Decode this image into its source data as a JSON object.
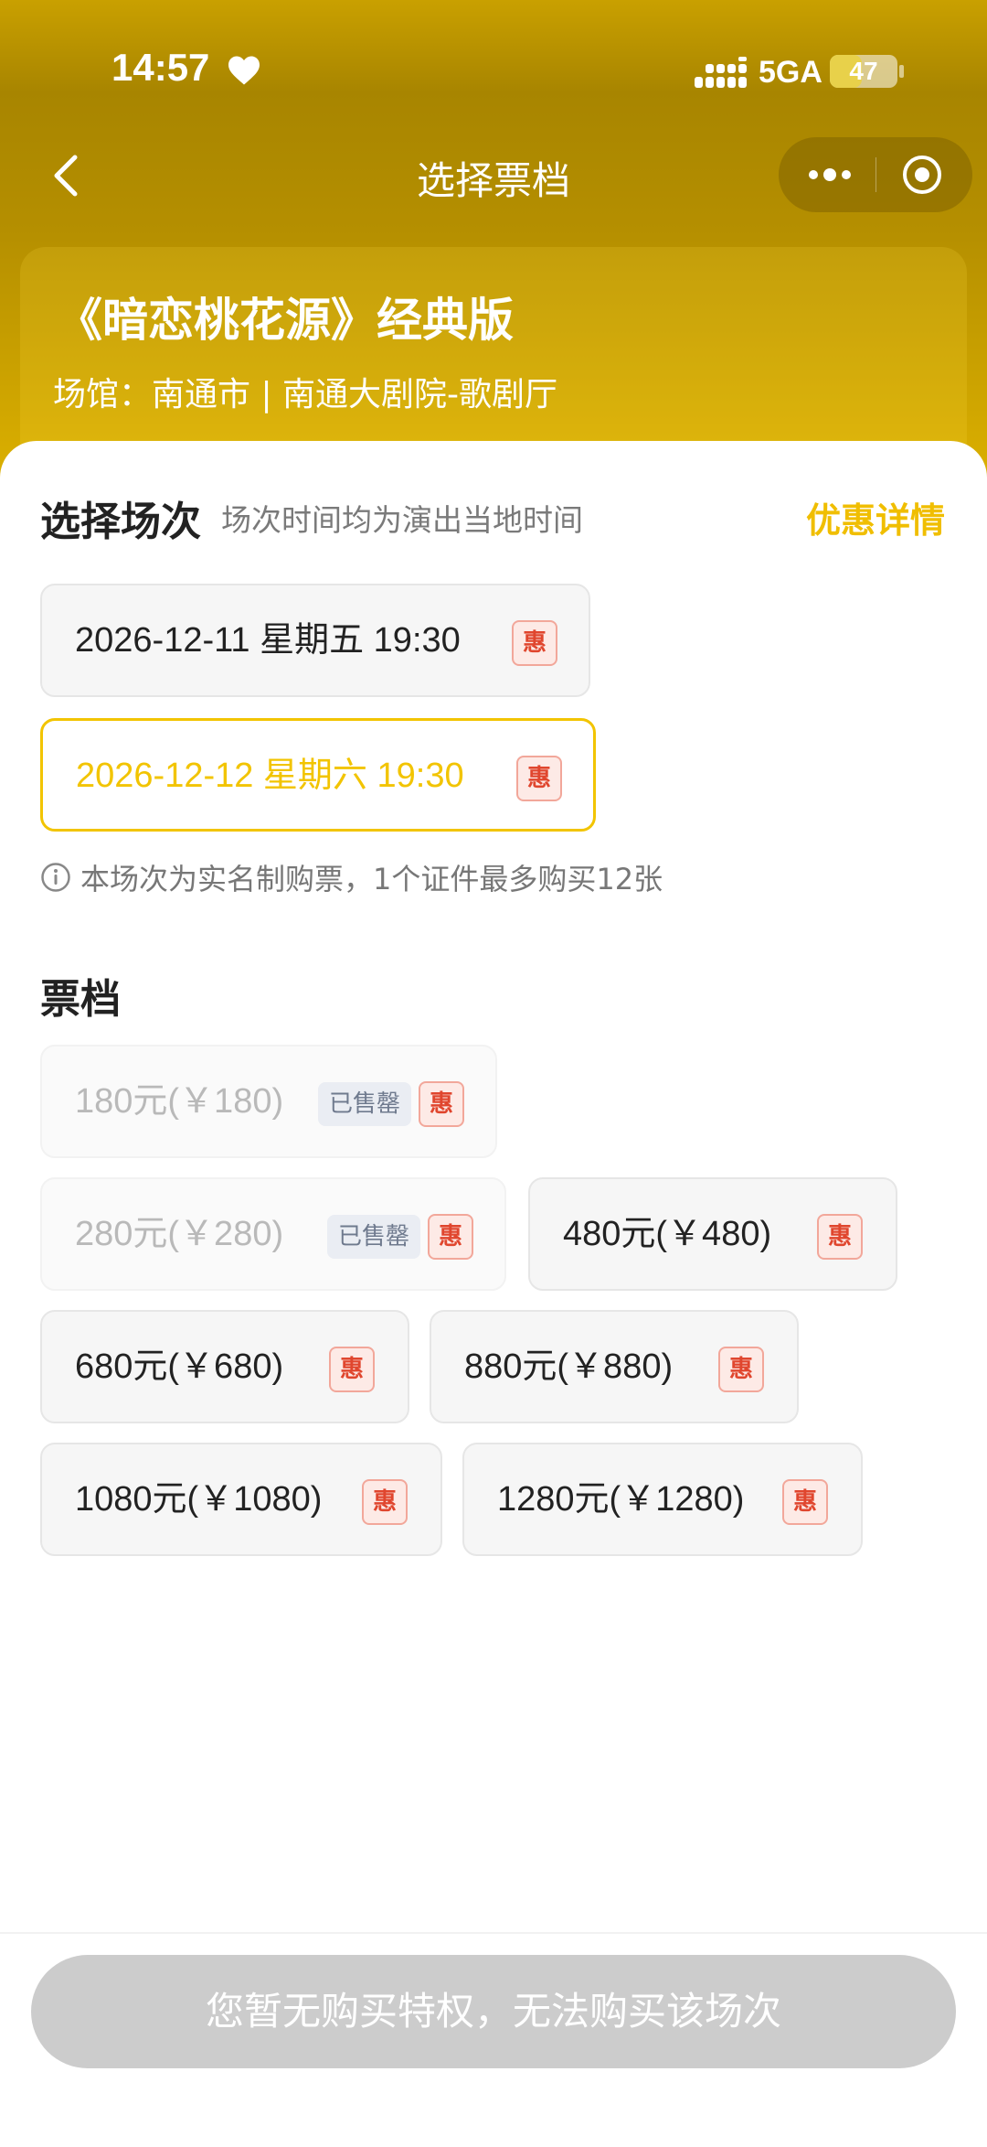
{
  "status_bar": {
    "time": "14:57",
    "network": "5GA",
    "battery": "47",
    "battery_level": 0.47
  },
  "nav": {
    "title": "选择票档"
  },
  "show": {
    "title": "《暗恋桃花源》经典版",
    "venue": "场馆：南通市 | 南通大剧院-歌剧厅"
  },
  "sessions_section": {
    "title": "选择场次",
    "hint": "场次时间均为演出当地时间",
    "discount_link": "优惠详情",
    "sessions": [
      {
        "label": "2026-12-11 星期五 19:30",
        "badge": "惠",
        "selected": false
      },
      {
        "label": "2026-12-12 星期六 19:30",
        "badge": "惠",
        "selected": true
      }
    ],
    "notice": "本场次为实名制购票，1个证件最多购买12张"
  },
  "tiers_section": {
    "title": "票档",
    "tiers": [
      {
        "label": "180元(￥180)",
        "sold_out": "已售罄",
        "badge": "惠"
      },
      {
        "label": "280元(￥280)",
        "sold_out": "已售罄",
        "badge": "惠"
      },
      {
        "label": "480元(￥480)",
        "badge": "惠"
      },
      {
        "label": "680元(￥680)",
        "badge": "惠"
      },
      {
        "label": "880元(￥880)",
        "badge": "惠"
      },
      {
        "label": "1080元(￥1080)",
        "badge": "惠"
      },
      {
        "label": "1280元(￥1280)",
        "badge": "惠"
      }
    ]
  },
  "footer": {
    "button": "您暂无购买特权，无法购买该场次"
  },
  "colors": {
    "accent": "#f2c400",
    "discount_badge": "#e0462e",
    "disabled_button": "#cccccc"
  }
}
